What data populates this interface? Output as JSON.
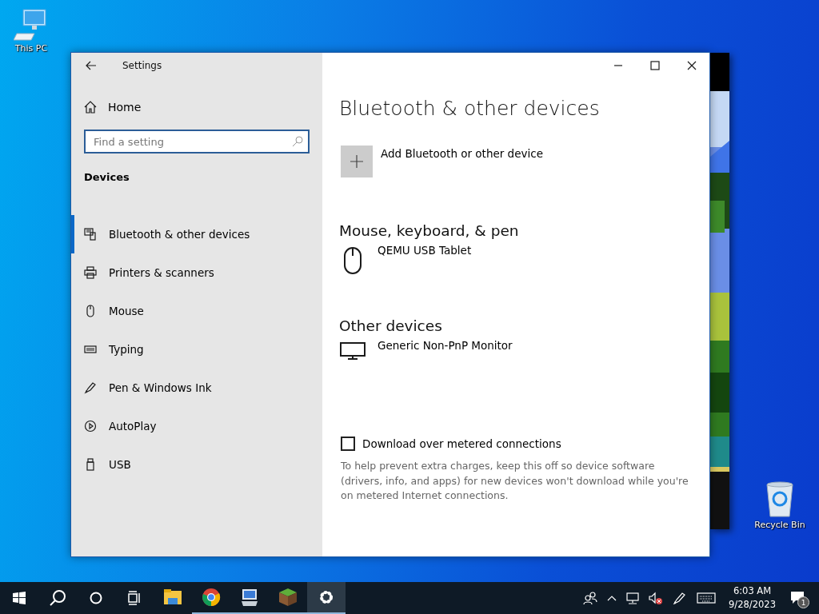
{
  "desktop_icons": [
    {
      "label": "This PC"
    },
    {
      "label": "Recycle Bin"
    }
  ],
  "window": {
    "title": "Settings"
  },
  "sidebar": {
    "home": "Home",
    "search": {
      "placeholder": "Find a setting"
    },
    "section": "Devices",
    "items": [
      {
        "label": "Bluetooth & other devices",
        "selected": true
      },
      {
        "label": "Printers & scanners",
        "selected": false
      },
      {
        "label": "Mouse",
        "selected": false
      },
      {
        "label": "Typing",
        "selected": false
      },
      {
        "label": "Pen & Windows Ink",
        "selected": false
      },
      {
        "label": "AutoPlay",
        "selected": false
      },
      {
        "label": "USB",
        "selected": false
      }
    ]
  },
  "content": {
    "title": "Bluetooth & other devices",
    "add_button": "Add Bluetooth or other device",
    "groups": [
      {
        "heading": "Mouse, keyboard, & pen",
        "devices": [
          {
            "kind": "mouse",
            "name": "QEMU USB Tablet"
          }
        ]
      },
      {
        "heading": "Other devices",
        "devices": [
          {
            "kind": "monitor",
            "name": "Generic Non-PnP Monitor"
          }
        ]
      }
    ],
    "metered": {
      "label": "Download over metered connections",
      "checked": false,
      "description": "To help prevent extra charges, keep this off so device software (drivers, info, and apps) for new devices won't download while you're on metered Internet connections."
    }
  },
  "taskbar": {
    "apps": [
      {
        "kind": "explorer",
        "running": false,
        "selected": false
      },
      {
        "kind": "chrome",
        "running": true,
        "selected": false
      },
      {
        "kind": "remote",
        "running": true,
        "selected": false
      },
      {
        "kind": "minecraft",
        "running": true,
        "selected": false
      },
      {
        "kind": "settings",
        "running": true,
        "selected": true
      }
    ],
    "time": "6:03 AM",
    "date": "9/28/2023",
    "notifications": "1"
  }
}
